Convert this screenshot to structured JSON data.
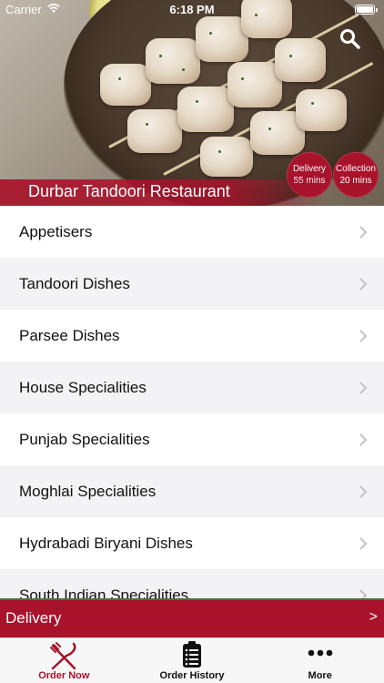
{
  "status_bar": {
    "carrier": "Carrier",
    "time": "6:18 PM"
  },
  "header": {
    "restaurant_name": "Durbar Tandoori Restaurant",
    "delivery_badge": {
      "label": "Delivery",
      "time": "55 mins"
    },
    "collection_badge": {
      "label": "Collection",
      "time": "20 mins"
    }
  },
  "menu": {
    "items": [
      {
        "label": "Appetisers"
      },
      {
        "label": "Tandoori Dishes"
      },
      {
        "label": "Parsee Dishes"
      },
      {
        "label": "House Specialities"
      },
      {
        "label": "Punjab Specialities"
      },
      {
        "label": "Moghlai Specialities"
      },
      {
        "label": "Hydrabadi Biryani Dishes"
      },
      {
        "label": "South Indian Specialities"
      }
    ]
  },
  "delivery_bar": {
    "label": "Delivery",
    "arrow": ">"
  },
  "tabbar": {
    "tabs": [
      {
        "label": "Order Now",
        "icon": "fork-knife-icon",
        "active": true
      },
      {
        "label": "Order History",
        "icon": "clipboard-list-icon",
        "active": false
      },
      {
        "label": "More",
        "icon": "more-dots-icon",
        "active": false
      }
    ]
  },
  "colors": {
    "brand": "#a8132b",
    "list_alt": "#f3f3f5"
  }
}
